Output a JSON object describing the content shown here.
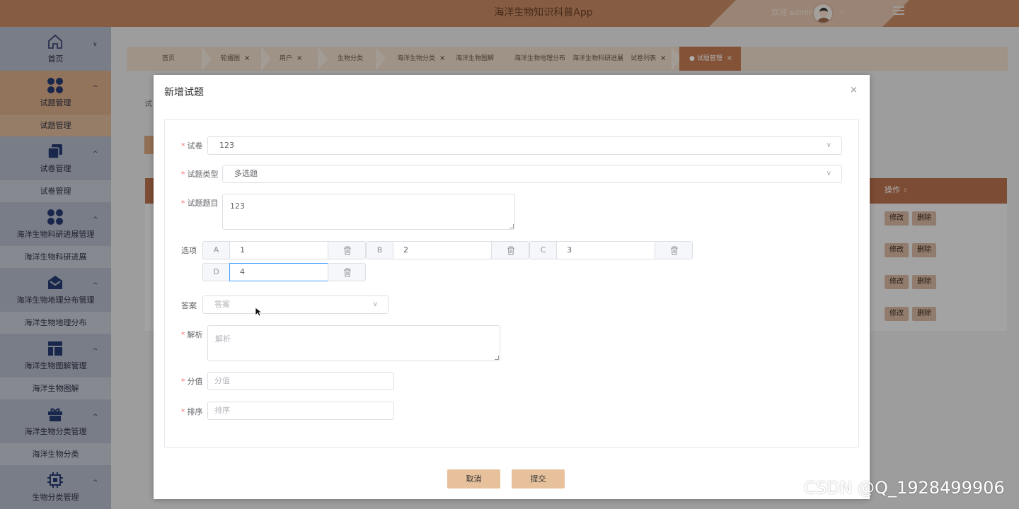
{
  "header": {
    "title": "海洋生物知识科普App",
    "welcome": "欢迎 admin"
  },
  "sidebar": {
    "groups": [
      {
        "label": "首页",
        "icon": "home-icon",
        "arrow": "∨"
      },
      {
        "label": "试题管理",
        "icon": "apps-icon",
        "arrow": "^",
        "sub": "试题管理",
        "active": true
      },
      {
        "label": "试卷管理",
        "icon": "copy-icon",
        "arrow": "^",
        "sub": "试卷管理"
      },
      {
        "label": "海洋生物科研进展管理",
        "icon": "apps-icon",
        "arrow": "^",
        "sub": "海洋生物科研进展"
      },
      {
        "label": "海洋生物地理分布管理",
        "icon": "mail-icon",
        "arrow": "^",
        "sub": "海洋生物地理分布"
      },
      {
        "label": "海洋生物图解管理",
        "icon": "layout-icon",
        "arrow": "^",
        "sub": "海洋生物图解"
      },
      {
        "label": "海洋生物分类管理",
        "icon": "gift-icon",
        "arrow": "^",
        "sub": "海洋生物分类"
      },
      {
        "label": "生物分类管理",
        "icon": "chip-icon",
        "arrow": "^"
      }
    ]
  },
  "tabs": [
    "首页",
    "轮播图",
    "用户",
    "生物分类",
    "海洋生物分类",
    "海洋生物图解",
    "海洋生物地理分布",
    "海洋生物科研进展",
    "试卷列表",
    "试题管理"
  ],
  "main": {
    "crumb": "试",
    "op_header": "操作",
    "edit": "修改",
    "delete": "删除"
  },
  "dialog": {
    "title": "新增试题",
    "close": "×",
    "fields": {
      "paper": {
        "label": "试卷",
        "value": "123"
      },
      "type": {
        "label": "试题类型",
        "value": "多选题"
      },
      "question": {
        "label": "试题题目",
        "value": "123"
      },
      "options_label": "选项",
      "answer": {
        "label": "答案",
        "placeholder": "答案"
      },
      "analysis": {
        "label": "解析",
        "placeholder": "解析"
      },
      "score": {
        "label": "分值",
        "placeholder": "分值"
      },
      "sort": {
        "label": "排序",
        "placeholder": "排序"
      }
    },
    "options": [
      {
        "key": "A",
        "value": "1"
      },
      {
        "key": "B",
        "value": "2"
      },
      {
        "key": "C",
        "value": "3"
      },
      {
        "key": "D",
        "value": "4"
      }
    ],
    "cancel": "取消",
    "submit": "提交"
  },
  "watermark": "CSDN @Q_1928499906",
  "colors": {
    "header": "#c68a64",
    "accent": "#b9714d",
    "button": "#e6c19c",
    "focus": "#409eff"
  }
}
